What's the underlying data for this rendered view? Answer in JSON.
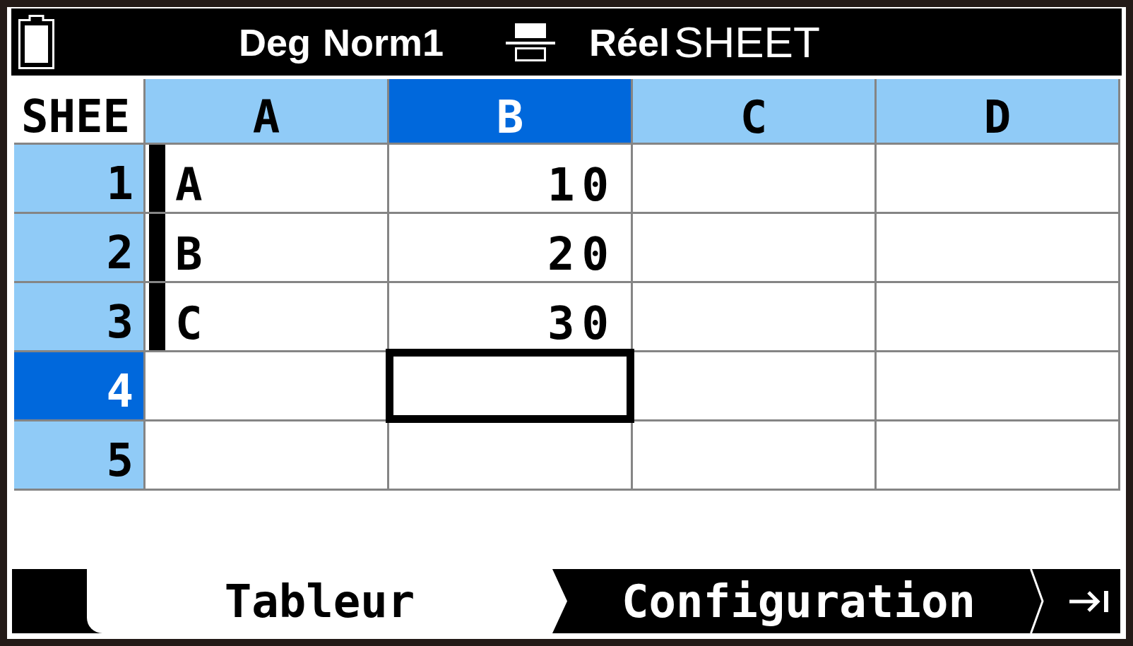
{
  "status_bar": {
    "angle_unit": "Deg",
    "number_format": "Norm1",
    "complex_mode": "Réel",
    "app_name": "SHEET"
  },
  "sheet": {
    "corner_label": "SHEE",
    "columns": [
      {
        "label": "A",
        "selected": false
      },
      {
        "label": "B",
        "selected": true
      },
      {
        "label": "C",
        "selected": false
      },
      {
        "label": "D",
        "selected": false
      }
    ],
    "rows": [
      {
        "label": "1",
        "selected": false,
        "cells": [
          {
            "kind": "text",
            "text": "A",
            "marked": true,
            "selected": false
          },
          {
            "kind": "number",
            "text": "10",
            "marked": false,
            "selected": false
          },
          {
            "marked": false,
            "selected": false
          },
          {
            "marked": false,
            "selected": false
          }
        ]
      },
      {
        "label": "2",
        "selected": false,
        "cells": [
          {
            "kind": "text",
            "text": "B",
            "marked": true,
            "selected": false
          },
          {
            "kind": "number",
            "text": "20",
            "marked": false,
            "selected": false
          },
          {
            "marked": false,
            "selected": false
          },
          {
            "marked": false,
            "selected": false
          }
        ]
      },
      {
        "label": "3",
        "selected": false,
        "cells": [
          {
            "kind": "text",
            "text": "C",
            "marked": true,
            "selected": false
          },
          {
            "kind": "number",
            "text": "30",
            "marked": false,
            "selected": false
          },
          {
            "marked": false,
            "selected": false
          },
          {
            "marked": false,
            "selected": false
          }
        ]
      },
      {
        "label": "4",
        "selected": true,
        "cells": [
          {
            "marked": false,
            "selected": false
          },
          {
            "marked": false,
            "selected": true
          },
          {
            "marked": false,
            "selected": false
          },
          {
            "marked": false,
            "selected": false
          }
        ]
      },
      {
        "label": "5",
        "selected": false,
        "cells": [
          {
            "marked": false,
            "selected": false
          },
          {
            "marked": false,
            "selected": false
          },
          {
            "marked": false,
            "selected": false
          },
          {
            "marked": false,
            "selected": false
          }
        ]
      }
    ]
  },
  "soft_keys": [
    {
      "label": "Tableur",
      "selected": true
    },
    {
      "label": "Configuration",
      "selected": false
    }
  ]
}
